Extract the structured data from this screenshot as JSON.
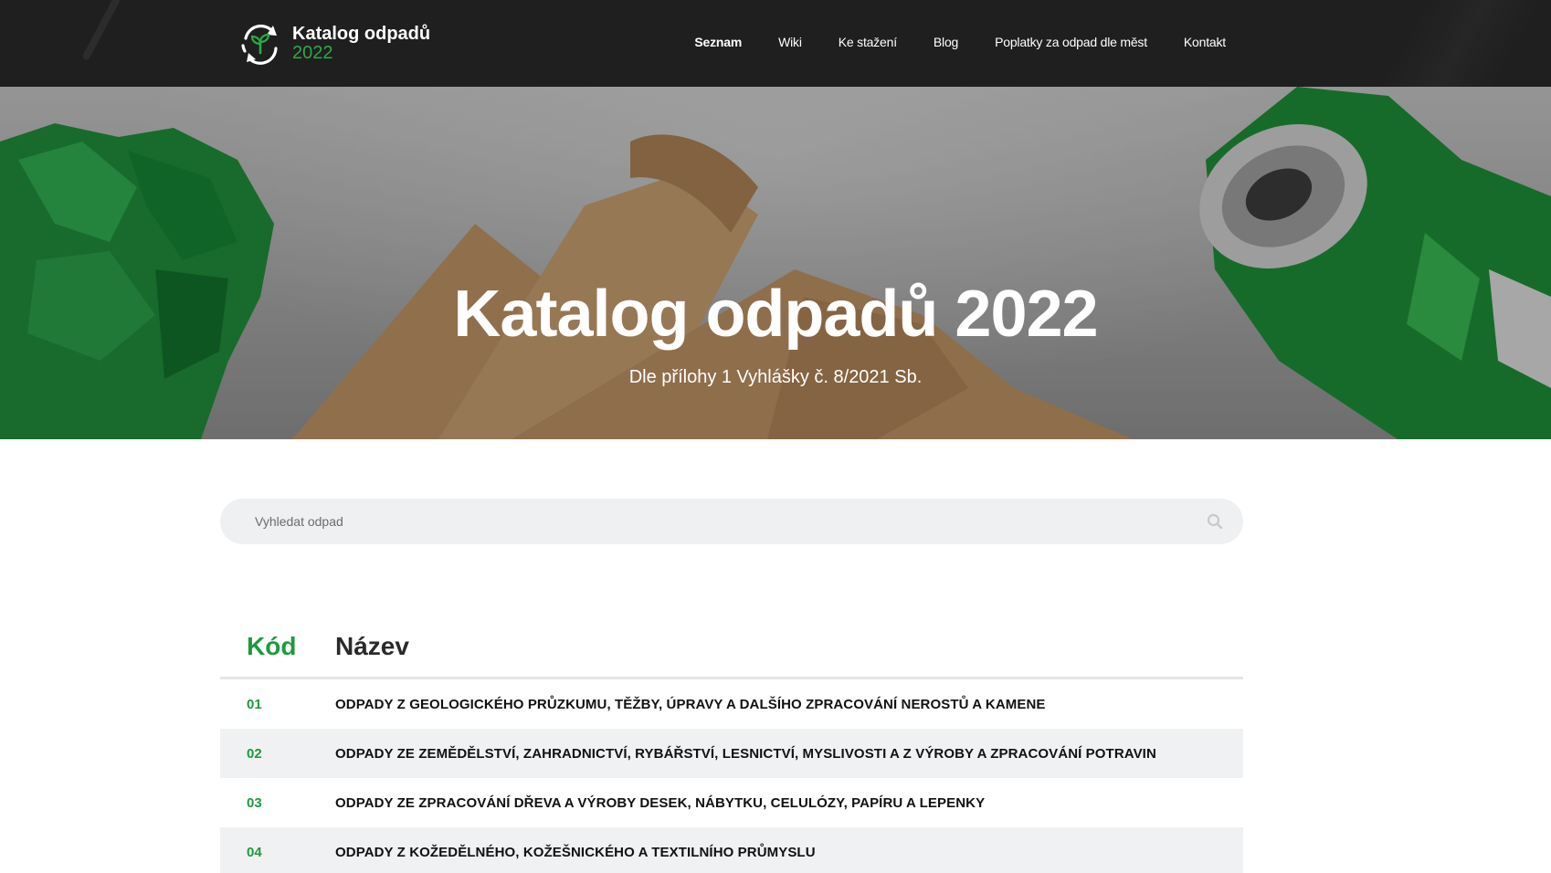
{
  "brand": {
    "name": "Katalog odpadů",
    "year": "2022",
    "accent_color": "#2ea84a"
  },
  "nav": {
    "items": [
      {
        "label": "Seznam",
        "active": true
      },
      {
        "label": "Wiki",
        "active": false
      },
      {
        "label": "Ke stažení",
        "active": false
      },
      {
        "label": "Blog",
        "active": false
      },
      {
        "label": "Poplatky za odpad dle měst",
        "active": false
      },
      {
        "label": "Kontakt",
        "active": false
      }
    ]
  },
  "hero": {
    "title": "Katalog odpadů 2022",
    "subtitle": "Dle přílohy 1 Vyhlášky č. 8/2021 Sb.",
    "background": "photo of crumpled green paper, kraft paper rolls and a crushed green can"
  },
  "search": {
    "placeholder": "Vyhledat odpad",
    "value": "",
    "icon": "search-icon"
  },
  "table": {
    "headers": {
      "code": "Kód",
      "name": "Název"
    },
    "rows": [
      {
        "code": "01",
        "name": "ODPADY Z GEOLOGICKÉHO PRŮZKUMU, TĚŽBY, ÚPRAVY A DALŠÍHO ZPRACOVÁNÍ NEROSTŮ A KAMENE"
      },
      {
        "code": "02",
        "name": "ODPADY ZE ZEMĚDĚLSTVÍ, ZAHRADNICTVÍ, RYBÁŘSTVÍ, LESNICTVÍ, MYSLIVOSTI A Z VÝROBY A ZPRACOVÁNÍ POTRAVIN"
      },
      {
        "code": "03",
        "name": "ODPADY ZE ZPRACOVÁNÍ DŘEVA A VÝROBY DESEK, NÁBYTKU, CELULÓZY, PAPÍRU A LEPENKY"
      },
      {
        "code": "04",
        "name": "ODPADY Z KOŽEDĚLNÉHO, KOŽEŠNICKÉHO A TEXTILNÍHO PRŮMYSLU"
      }
    ]
  }
}
